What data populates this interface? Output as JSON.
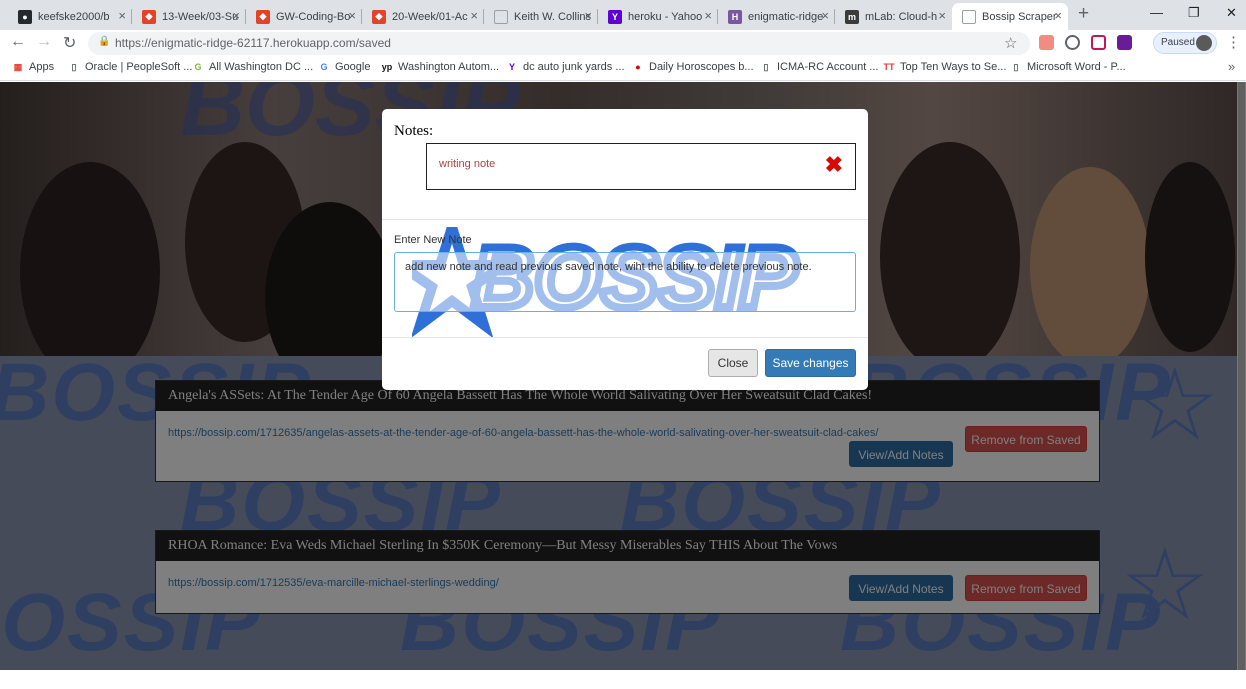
{
  "browser": {
    "tabs": [
      {
        "title": "keefske2000/b",
        "icon": "github-icon",
        "color": "#24292e",
        "glyph": "●"
      },
      {
        "title": "13-Week/03-Su",
        "icon": "gitlab-icon",
        "color": "#e24329",
        "glyph": "◆"
      },
      {
        "title": "GW-Coding-Bo",
        "icon": "gitlab-icon",
        "color": "#e24329",
        "glyph": "◆"
      },
      {
        "title": "20-Week/01-Ac",
        "icon": "gitlab-icon",
        "color": "#e24329",
        "glyph": "◆"
      },
      {
        "title": "Keith W. Collins",
        "icon": "page-icon",
        "color": "#9aa0a6",
        "glyph": ""
      },
      {
        "title": "heroku - Yahoo",
        "icon": "yahoo-icon",
        "color": "#5f01d1",
        "glyph": "Y"
      },
      {
        "title": "enigmatic-ridge",
        "icon": "heroku-icon",
        "color": "#79589f",
        "glyph": "H"
      },
      {
        "title": "mLab: Cloud-h",
        "icon": "mlab-icon",
        "color": "#3b3b3b",
        "glyph": "m"
      },
      {
        "title": "Bossip Scraper",
        "icon": "page-icon",
        "color": "#9aa0a6",
        "glyph": ""
      }
    ],
    "new_tab": "+",
    "window_controls": {
      "minimize": "—",
      "restore": "❐",
      "close": "✕"
    },
    "url": "https://enigmatic-ridge-62117.herokuapp.com/saved",
    "profile_status": "Paused",
    "bookmarks": [
      {
        "label": "Apps",
        "icon": "apps-icon",
        "color": "#e94235",
        "glyph": "▦"
      },
      {
        "label": "Oracle | PeopleSoft ...",
        "icon": "page-icon",
        "color": "#5f6368",
        "glyph": "▯"
      },
      {
        "label": "All Washington DC ...",
        "icon": "dc-icon",
        "color": "#7cb342",
        "glyph": "G"
      },
      {
        "label": "Google",
        "icon": "google-icon",
        "color": "#4285f4",
        "glyph": "G"
      },
      {
        "label": "Washington Autom...",
        "icon": "yp-icon",
        "color": "#111111",
        "glyph": "yp"
      },
      {
        "label": "dc auto junk yards ...",
        "icon": "yahoo-icon",
        "color": "#5f01d1",
        "glyph": "Y"
      },
      {
        "label": "Daily Horoscopes b...",
        "icon": "horoscope-icon",
        "color": "#d50000",
        "glyph": "●"
      },
      {
        "label": "ICMA-RC Account ...",
        "icon": "page-icon",
        "color": "#5f6368",
        "glyph": "▯"
      },
      {
        "label": "Top Ten Ways to Se...",
        "icon": "tt-icon",
        "color": "#e53935",
        "glyph": "TT"
      },
      {
        "label": "Microsoft Word - P...",
        "icon": "page-icon",
        "color": "#5f6368",
        "glyph": "▯"
      }
    ],
    "bookmarks_more": "»"
  },
  "page": {
    "hero_watermark": "BOSSIP",
    "pattern_word": "BOSSIP",
    "articles": [
      {
        "title": "Angela's ASSets: At The Tender Age Of 60 Angela Bassett Has The Whole World Salivating Over Her Sweatsuit Clad Cakes!",
        "link": "https://bossip.com/1712635/angelas-assets-at-the-tender-age-of-60-angela-bassett-has-the-whole-world-salivating-over-her-sweatsuit-clad-cakes/",
        "notes_label": "View/Add Notes",
        "remove_label": "Remove from Saved"
      },
      {
        "title": "RHOA Romance: Eva Weds Michael Sterling In $350K Ceremony—But Messy Miserables Say THIS About The Vows",
        "link": "https://bossip.com/1712535/eva-marcille-michael-sterlings-wedding/",
        "notes_label": "View/Add Notes",
        "remove_label": "Remove from Saved"
      }
    ]
  },
  "modal": {
    "title": "Notes:",
    "existing_note": "writing note",
    "delete_glyph": "✖",
    "new_note_label": "Enter New Note",
    "new_note_value": "add new note and read previous saved note, wiht the ability to delete previous note.",
    "logo_watermark": "BOSSIP",
    "close_label": "Close",
    "save_label": "Save changes"
  }
}
